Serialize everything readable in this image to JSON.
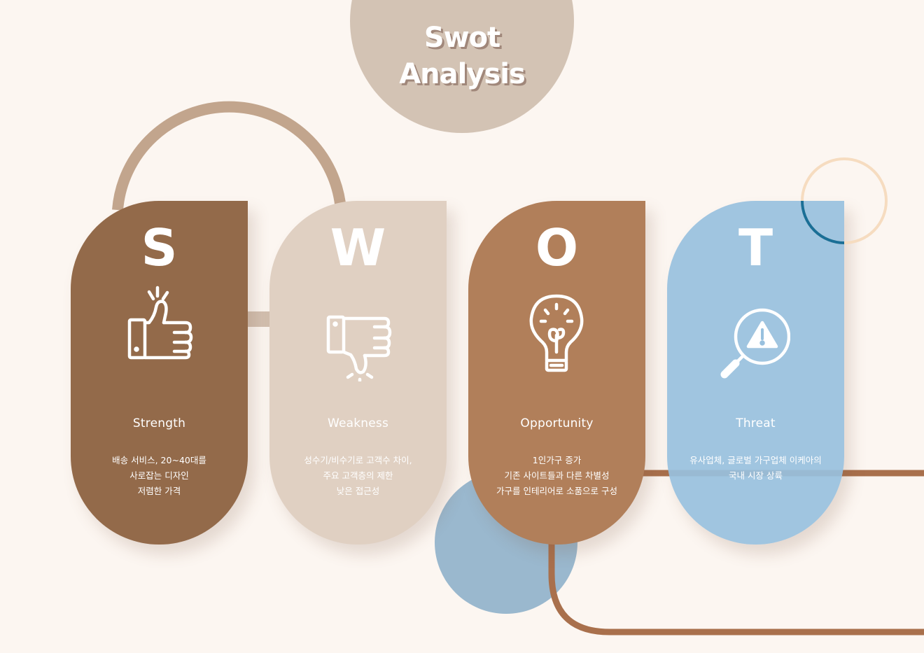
{
  "title": {
    "line1": "Swot",
    "line2": "Analysis"
  },
  "colors": {
    "background": "#fcf6f1",
    "title_disc": "#d3c3b4",
    "strength": "#936a4a",
    "weakness": "#e0d0c2",
    "opportunity": "#b17f5a",
    "threat": "#98c0de",
    "arc": "#c2a58d",
    "line": "#a9704c",
    "blue_disc": "#8fb1ca"
  },
  "cards": [
    {
      "key": "strength",
      "letter": "S",
      "icon": "thumbs-up-icon",
      "label": "Strength",
      "lines": [
        "배송 서비스, 20~40대를",
        "사로잡는 디자인",
        "저렴한 가격"
      ]
    },
    {
      "key": "weakness",
      "letter": "W",
      "icon": "thumbs-down-icon",
      "label": "Weakness",
      "lines": [
        "성수기/비수기로 고객수 차이,",
        "주요 고객층의 제한",
        "낮은 접근성"
      ]
    },
    {
      "key": "opportunity",
      "letter": "O",
      "icon": "lightbulb-icon",
      "label": "Opportunity",
      "lines": [
        "1인가구 증가",
        "기존 사이트들과 다른 차별성",
        "가구를 인테리어로 소품으로 구성"
      ]
    },
    {
      "key": "threat",
      "letter": "T",
      "icon": "magnifier-warning-icon",
      "label": "Threat",
      "lines": [
        "유사업체, 글로벌 가구업체 이케아의",
        "국내 시장 상륙"
      ]
    }
  ]
}
